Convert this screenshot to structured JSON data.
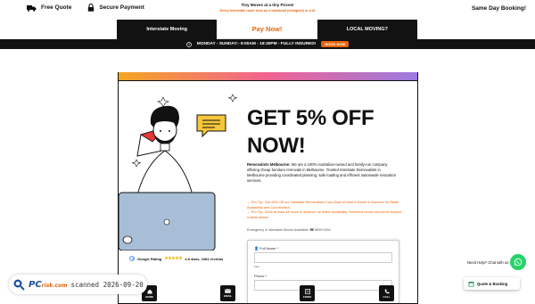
{
  "topbar": {
    "free_quote": "Free Quote",
    "secure_payment": "Secure Payment",
    "promo_title": "Tiny Moves at a tiny Prices!",
    "promo_sub": "Every Interstate route runs as a backload (cheapest) or a dl",
    "same_day": "Same Day Booking!"
  },
  "nav": {
    "tabs": [
      {
        "label": "Interstate Moving"
      },
      {
        "label": "Pay Now!"
      },
      {
        "label": "LOCAL MOVING?"
      }
    ]
  },
  "strip": {
    "hours": "MONDAY - SUNDAY:- 9:00AM - 18:30PM - FULLY INSURED!",
    "book_now": "BOOK NOW"
  },
  "hero": {
    "heading_line1": "GET 5% OFF",
    "heading_line2": "NOW!",
    "desc_brand": "Removalists Melbourne:",
    "desc_body": " We are a 100% Australian-owned and family-run company offering cheap furniture removals in Melbourne. Trusted Interstate Removalists in Melbourne providing coordinated planning, safe loading and efficient nationwide relocation services.",
    "tip1": "→ Pro Tip:- Get 50% Off our Interstate Removalists if you Book at least a Month in Advance for Better Availability and Coordination.",
    "tip2": "→ Pro Tip:- Book at least 48 hours in advance for better availability. Weekend moves should be booked a week ahead.",
    "emergency": "Emergency & Interstate Moves Available! ☎ 8599 0001",
    "rating_label": "Google Rating",
    "rating_text": "4.8 stars, 1081 reviews"
  },
  "form": {
    "name_label": "👤 Full Name *",
    "name_hint": "First",
    "phone_label": "Phone *"
  },
  "bottom": {
    "home": "HOME",
    "email": "EMAIL",
    "form": "FORM",
    "call": "CALL"
  },
  "widgets": {
    "help": "Need Help? Chat with us",
    "quote_booking": "Quote & Booking"
  },
  "watermark": {
    "logo": "PC",
    "logo_suffix": "risk.com",
    "scan": "scanned 2026-09-20"
  },
  "colors": {
    "accent": "#e8640c",
    "dark": "#121212",
    "whatsapp": "#25d366"
  }
}
